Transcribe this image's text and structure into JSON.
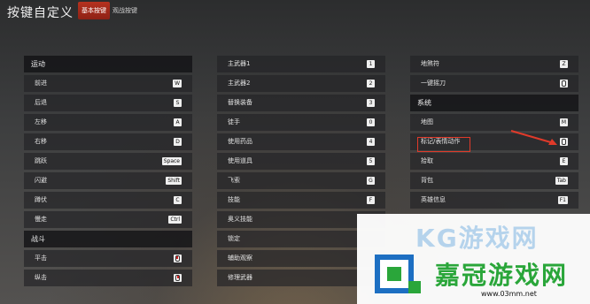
{
  "title": "按键自定义",
  "tabs": [
    {
      "label": "基本按键",
      "active": true
    },
    {
      "label": "观战按键",
      "active": false
    }
  ],
  "columns": [
    {
      "sections": [
        {
          "header": "运动",
          "rows": [
            {
              "label": "前进",
              "key": "W"
            },
            {
              "label": "后退",
              "key": "S"
            },
            {
              "label": "左移",
              "key": "A"
            },
            {
              "label": "右移",
              "key": "D"
            },
            {
              "label": "跳跃",
              "key": "Space"
            },
            {
              "label": "闪避",
              "key": "Shift"
            },
            {
              "label": "蹲伏",
              "key": "C"
            },
            {
              "label": "慢走",
              "key": "Ctrl"
            }
          ]
        },
        {
          "header": "战斗",
          "rows": [
            {
              "label": "平击",
              "key": "mouse-left-icon"
            },
            {
              "label": "纵击",
              "key": "mouse-right-icon"
            }
          ]
        }
      ]
    },
    {
      "sections": [
        {
          "header": "",
          "rows": [
            {
              "label": "主武器1",
              "key": "1"
            },
            {
              "label": "主武器2",
              "key": "2"
            },
            {
              "label": "替换装备",
              "key": "3"
            },
            {
              "label": "徒手",
              "key": "0"
            },
            {
              "label": "使用药品",
              "key": "4"
            },
            {
              "label": "使用道具",
              "key": "5"
            },
            {
              "label": "飞索",
              "key": "G"
            },
            {
              "label": "技能",
              "key": "F"
            },
            {
              "label": "奥义技能",
              "key": ""
            },
            {
              "label": "锁定",
              "key": ""
            },
            {
              "label": "辅助观察",
              "key": ""
            },
            {
              "label": "修理武器",
              "key": ""
            }
          ]
        }
      ]
    },
    {
      "sections": [
        {
          "header": "",
          "rows": [
            {
              "label": "地煞符",
              "key": "Z"
            },
            {
              "label": "一键摇刀",
              "key": "mouse-wheel-icon"
            }
          ]
        },
        {
          "header": "系统",
          "rows": [
            {
              "label": "地图",
              "key": "M"
            },
            {
              "label": "标记/表情动作",
              "key": "mouse-middle-icon"
            },
            {
              "label": "拾取",
              "key": "E"
            },
            {
              "label": "背包",
              "key": "Tab"
            },
            {
              "label": "英雄信息",
              "key": "F1"
            }
          ]
        }
      ]
    }
  ],
  "watermark": {
    "brand": "嘉冠游戏网",
    "url": "www.03mm.net",
    "faded": "KG游戏网"
  },
  "colors": {
    "accent": "#b5321f",
    "highlight_box": "#e03a2a",
    "watermark_green": "#2aa63a"
  }
}
